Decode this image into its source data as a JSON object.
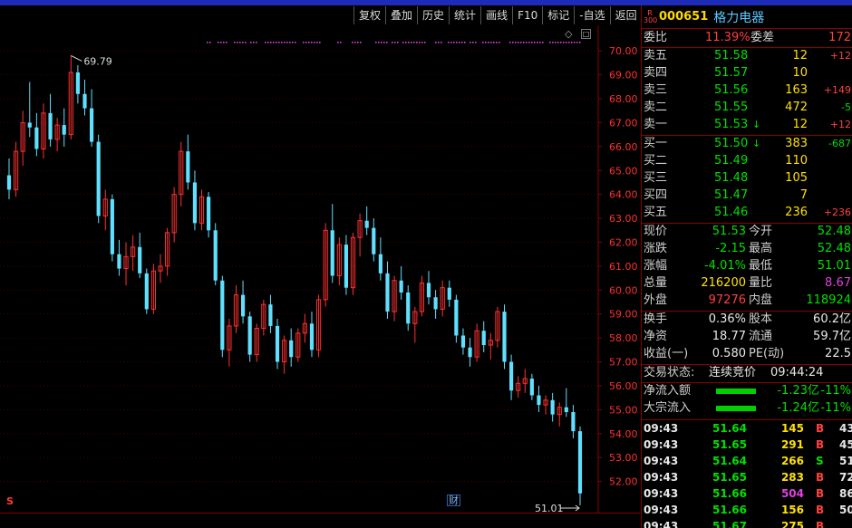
{
  "toolbar": [
    "复权",
    "叠加",
    "历史",
    "统计",
    "画线",
    "F10",
    "标记",
    "-自选",
    "返回"
  ],
  "chart": {
    "y_axis_labels": [
      "70.00",
      "69.00",
      "68.00",
      "67.00",
      "66.00",
      "65.00",
      "64.00",
      "63.00",
      "62.00",
      "61.00",
      "60.00",
      "59.00",
      "58.00",
      "57.00",
      "56.00",
      "55.00",
      "54.00",
      "53.00",
      "52.00"
    ],
    "high_label": "69.79",
    "low_label": "51.01",
    "marker_s": "S",
    "marker_cai": "财",
    "ctrl_symbol": "◇",
    "ctrl_box": "□",
    "colors": {
      "up": "#ff3030",
      "down": "#5fe0ff",
      "grid": "#6b0000",
      "axis_text": "#ff3030"
    }
  },
  "chart_data": {
    "type": "candlestick",
    "ylim": [
      51.0,
      70.5
    ],
    "candles": [
      [
        64.8,
        65.5,
        63.8,
        64.2
      ],
      [
        64.2,
        66.2,
        63.9,
        65.8
      ],
      [
        65.8,
        67.5,
        65.2,
        67.0
      ],
      [
        67.0,
        68.7,
        66.4,
        66.8
      ],
      [
        66.8,
        67.4,
        65.6,
        65.9
      ],
      [
        65.9,
        67.8,
        65.5,
        67.4
      ],
      [
        67.4,
        68.2,
        66.0,
        66.3
      ],
      [
        66.3,
        67.2,
        65.8,
        66.9
      ],
      [
        66.9,
        67.6,
        66.0,
        66.5
      ],
      [
        66.5,
        69.8,
        66.3,
        69.1
      ],
      [
        69.1,
        69.4,
        67.8,
        68.2
      ],
      [
        68.2,
        68.8,
        67.3,
        67.6
      ],
      [
        67.6,
        68.4,
        66.0,
        66.2
      ],
      [
        66.2,
        66.5,
        62.8,
        63.1
      ],
      [
        63.1,
        64.2,
        62.5,
        63.8
      ],
      [
        63.8,
        64.0,
        61.2,
        61.5
      ],
      [
        61.5,
        62.1,
        60.6,
        60.9
      ],
      [
        60.9,
        62.0,
        60.2,
        61.4
      ],
      [
        61.4,
        62.3,
        60.8,
        61.8
      ],
      [
        61.8,
        62.4,
        60.5,
        60.7
      ],
      [
        60.7,
        60.9,
        59.0,
        59.2
      ],
      [
        59.2,
        61.1,
        59.0,
        60.8
      ],
      [
        60.8,
        61.5,
        60.3,
        61.0
      ],
      [
        61.0,
        62.6,
        60.6,
        62.4
      ],
      [
        62.4,
        64.3,
        62.0,
        64.0
      ],
      [
        64.0,
        66.2,
        63.5,
        65.8
      ],
      [
        65.8,
        66.5,
        64.2,
        64.5
      ],
      [
        64.5,
        65.0,
        62.5,
        62.8
      ],
      [
        62.8,
        64.2,
        62.5,
        63.9
      ],
      [
        63.9,
        64.1,
        62.2,
        62.5
      ],
      [
        62.5,
        62.8,
        60.2,
        60.4
      ],
      [
        60.4,
        60.6,
        57.2,
        57.5
      ],
      [
        57.5,
        58.8,
        56.8,
        58.5
      ],
      [
        58.5,
        60.2,
        58.2,
        59.8
      ],
      [
        59.8,
        60.4,
        58.6,
        58.9
      ],
      [
        58.9,
        59.1,
        57.0,
        57.3
      ],
      [
        57.3,
        58.6,
        57.0,
        58.4
      ],
      [
        58.4,
        59.6,
        58.1,
        59.4
      ],
      [
        59.4,
        59.8,
        58.2,
        58.5
      ],
      [
        58.5,
        58.8,
        56.7,
        57.0
      ],
      [
        57.0,
        58.1,
        56.5,
        57.9
      ],
      [
        57.9,
        58.4,
        56.8,
        57.2
      ],
      [
        57.2,
        58.4,
        57.0,
        58.2
      ],
      [
        58.2,
        59.0,
        57.8,
        58.6
      ],
      [
        58.6,
        59.1,
        57.2,
        57.5
      ],
      [
        57.5,
        59.8,
        57.2,
        59.6
      ],
      [
        59.6,
        62.8,
        59.3,
        62.5
      ],
      [
        62.5,
        63.6,
        60.3,
        60.6
      ],
      [
        60.6,
        62.2,
        60.2,
        61.9
      ],
      [
        61.9,
        62.3,
        59.8,
        60.1
      ],
      [
        60.1,
        62.4,
        59.8,
        62.2
      ],
      [
        62.2,
        63.2,
        61.4,
        62.9
      ],
      [
        62.9,
        63.5,
        62.3,
        62.6
      ],
      [
        62.6,
        63.0,
        61.2,
        61.5
      ],
      [
        61.5,
        62.2,
        60.4,
        60.7
      ],
      [
        60.7,
        61.2,
        58.8,
        59.1
      ],
      [
        59.1,
        60.6,
        58.7,
        60.4
      ],
      [
        60.4,
        61.0,
        59.6,
        59.9
      ],
      [
        59.9,
        60.2,
        58.3,
        58.6
      ],
      [
        58.6,
        59.3,
        57.8,
        59.1
      ],
      [
        59.1,
        60.6,
        58.9,
        60.3
      ],
      [
        60.3,
        60.8,
        59.4,
        59.7
      ],
      [
        59.7,
        60.0,
        58.8,
        59.2
      ],
      [
        59.2,
        60.4,
        58.9,
        60.1
      ],
      [
        60.1,
        60.4,
        59.3,
        59.6
      ],
      [
        59.6,
        59.8,
        57.8,
        58.1
      ],
      [
        58.1,
        58.4,
        57.3,
        57.6
      ],
      [
        57.6,
        58.0,
        56.8,
        57.2
      ],
      [
        57.2,
        58.6,
        57.0,
        58.3
      ],
      [
        58.3,
        58.7,
        57.4,
        57.7
      ],
      [
        57.7,
        58.2,
        57.1,
        57.9
      ],
      [
        57.9,
        59.3,
        57.6,
        59.1
      ],
      [
        59.1,
        59.4,
        56.7,
        57.0
      ],
      [
        57.0,
        57.3,
        55.4,
        55.8
      ],
      [
        55.8,
        56.4,
        55.5,
        56.1
      ],
      [
        56.1,
        56.7,
        55.7,
        56.3
      ],
      [
        56.3,
        56.5,
        55.4,
        55.6
      ],
      [
        55.6,
        56.0,
        54.9,
        55.2
      ],
      [
        55.2,
        55.6,
        54.8,
        55.4
      ],
      [
        55.4,
        55.7,
        54.5,
        54.8
      ],
      [
        54.8,
        55.3,
        54.3,
        55.1
      ],
      [
        55.1,
        55.9,
        54.7,
        54.9
      ],
      [
        54.9,
        55.2,
        53.8,
        54.1
      ],
      [
        54.1,
        54.3,
        51.0,
        51.5
      ]
    ]
  },
  "panel": {
    "badge_top": "R",
    "badge_bottom": "300",
    "code": "000651",
    "name": "格力电器",
    "webi_label": "委比",
    "webi_value": "11.39%",
    "wecha_label": "委差",
    "wecha_value": "172",
    "asks": [
      {
        "label": "卖五",
        "price": "51.58",
        "vol": "12",
        "chg": "+12",
        "arrow": ""
      },
      {
        "label": "卖四",
        "price": "51.57",
        "vol": "10",
        "chg": "",
        "arrow": ""
      },
      {
        "label": "卖三",
        "price": "51.56",
        "vol": "163",
        "chg": "+149",
        "arrow": ""
      },
      {
        "label": "卖二",
        "price": "51.55",
        "vol": "472",
        "chg": "-5",
        "arrow": ""
      },
      {
        "label": "卖一",
        "price": "51.53",
        "vol": "12",
        "chg": "+12",
        "arrow": "↓"
      }
    ],
    "bids": [
      {
        "label": "买一",
        "price": "51.50",
        "vol": "383",
        "chg": "-687",
        "arrow": "↓"
      },
      {
        "label": "买二",
        "price": "51.49",
        "vol": "110",
        "chg": "",
        "arrow": ""
      },
      {
        "label": "买三",
        "price": "51.48",
        "vol": "105",
        "chg": "",
        "arrow": ""
      },
      {
        "label": "买四",
        "price": "51.47",
        "vol": "7",
        "chg": "",
        "arrow": ""
      },
      {
        "label": "买五",
        "price": "51.46",
        "vol": "236",
        "chg": "+236",
        "arrow": ""
      }
    ],
    "stats": [
      {
        "l1": "现价",
        "v1": "51.53",
        "c1": "green",
        "l2": "今开",
        "v2": "52.48",
        "c2": "green"
      },
      {
        "l1": "涨跌",
        "v1": "-2.15",
        "c1": "green",
        "l2": "最高",
        "v2": "52.48",
        "c2": "green"
      },
      {
        "l1": "涨幅",
        "v1": "-4.01%",
        "c1": "green",
        "l2": "最低",
        "v2": "51.01",
        "c2": "green"
      },
      {
        "l1": "总量",
        "v1": "216200",
        "c1": "yellow",
        "l2": "量比",
        "v2": "8.67",
        "c2": "magenta"
      },
      {
        "l1": "外盘",
        "v1": "97276",
        "c1": "red",
        "l2": "内盘",
        "v2": "118924",
        "c2": "green"
      }
    ],
    "stats2": [
      {
        "l1": "换手",
        "v1": "0.36%",
        "l2": "股本",
        "v2": "60.2亿"
      },
      {
        "l1": "净资",
        "v1": "18.77",
        "l2": "流通",
        "v2": "59.7亿"
      },
      {
        "l1": "收益(一)",
        "v1": "0.580",
        "l2": "PE(动)",
        "v2": "22.5"
      }
    ],
    "trade_status_label": "交易状态:",
    "trade_status_value": "连续竞价",
    "trade_status_time": "09:44:24",
    "flows": [
      {
        "label": "净流入额",
        "amount": "-1.23亿",
        "pct": "-11%"
      },
      {
        "label": "大宗流入",
        "amount": "-1.24亿",
        "pct": "-11%"
      }
    ],
    "ticks": [
      {
        "time": "09:43",
        "price": "51.64",
        "vol": "145",
        "side": "B",
        "tail": "43",
        "volcolor": "yellow",
        "sidecolor": "red"
      },
      {
        "time": "09:43",
        "price": "51.65",
        "vol": "291",
        "side": "B",
        "tail": "45",
        "volcolor": "yellow",
        "sidecolor": "red"
      },
      {
        "time": "09:43",
        "price": "51.64",
        "vol": "266",
        "side": "S",
        "tail": "51",
        "volcolor": "yellow",
        "sidecolor": "green"
      },
      {
        "time": "09:43",
        "price": "51.65",
        "vol": "283",
        "side": "B",
        "tail": "72",
        "volcolor": "yellow",
        "sidecolor": "red"
      },
      {
        "time": "09:43",
        "price": "51.66",
        "vol": "504",
        "side": "B",
        "tail": "86",
        "volcolor": "magenta",
        "sidecolor": "red"
      },
      {
        "time": "09:43",
        "price": "51.66",
        "vol": "156",
        "side": "B",
        "tail": "50",
        "volcolor": "yellow",
        "sidecolor": "red"
      },
      {
        "time": "09:43",
        "price": "51.67",
        "vol": "275",
        "side": "B",
        "tail": "",
        "volcolor": "yellow",
        "sidecolor": "red"
      }
    ]
  }
}
